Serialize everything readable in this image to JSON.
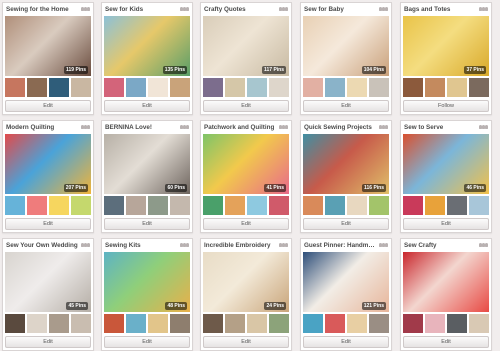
{
  "boards": [
    {
      "title": "Sewing for the Home",
      "pins": "119 Pins",
      "button": "Edit",
      "cover": [
        "#b08f7a",
        "#6b4d3f",
        "#d9cbbf"
      ],
      "thumbs": [
        "#c6765f",
        "#8a6a52",
        "#2f5d7a",
        "#c9b7a2"
      ]
    },
    {
      "title": "Sew for Kids",
      "pins": "135 Pins",
      "button": "Edit",
      "cover": [
        "#8cc1d8",
        "#5a9e68",
        "#e6c86a"
      ],
      "thumbs": [
        "#d3647a",
        "#7ba8c6",
        "#f1e5d7",
        "#c9a37a"
      ]
    },
    {
      "title": "Crafty Quotes",
      "pins": "117 Pins",
      "button": "Edit",
      "cover": [
        "#d9cdb9",
        "#c8baa2",
        "#eee4d4"
      ],
      "thumbs": [
        "#7c6d8d",
        "#d5c7a8",
        "#a7c6cf",
        "#ded6cb"
      ]
    },
    {
      "title": "Sew for Baby",
      "pins": "104 Pins",
      "button": "Edit",
      "cover": [
        "#e8d0b4",
        "#c9a07a",
        "#f5e9db"
      ],
      "thumbs": [
        "#e2b0a3",
        "#8ab3c9",
        "#ecd9b2",
        "#c9c2b9"
      ]
    },
    {
      "title": "Bags and Totes",
      "pins": "37 Pins",
      "button": "Follow",
      "cover": [
        "#e9c348",
        "#d9a92a",
        "#f4dd80"
      ],
      "thumbs": [
        "#8c5a3c",
        "#c48a5e",
        "#e0c690",
        "#7b6a5e"
      ]
    },
    {
      "title": "Modern Quilting",
      "pins": "207 Pins",
      "button": "Edit",
      "cover": [
        "#e24a4a",
        "#f0b43a",
        "#4aa3d9"
      ],
      "thumbs": [
        "#66b3d9",
        "#ef7c7c",
        "#f6d65f",
        "#c5d86d"
      ]
    },
    {
      "title": "BERNINA Love!",
      "pins": "60 Pins",
      "button": "Edit",
      "cover": [
        "#b7b0a6",
        "#6e655e",
        "#e3ddd5"
      ],
      "thumbs": [
        "#5c6e7c",
        "#b7a69a",
        "#8d9a8a",
        "#c4b8ad"
      ]
    },
    {
      "title": "Patchwork and Quilting",
      "pins": "41 Pins",
      "button": "Edit",
      "cover": [
        "#7ec468",
        "#e86a8a",
        "#f2c94c"
      ],
      "thumbs": [
        "#4aa06a",
        "#e4a25a",
        "#8ec9e0",
        "#d05a6a"
      ]
    },
    {
      "title": "Quick Sewing Projects",
      "pins": "116 Pins",
      "button": "Edit",
      "cover": [
        "#3f8fa3",
        "#e0c06a",
        "#c75a4a"
      ],
      "thumbs": [
        "#d98a5a",
        "#5aa0b4",
        "#e8d8c0",
        "#a3c46a"
      ]
    },
    {
      "title": "Sew to Serve",
      "pins": "46 Pins",
      "button": "Edit",
      "cover": [
        "#d9502f",
        "#f2c14a",
        "#7bb6d9"
      ],
      "thumbs": [
        "#c93a5a",
        "#e8a23a",
        "#6a6e74",
        "#a8c6d9"
      ]
    },
    {
      "title": "Sew Your Own Wedding",
      "pins": "45 Pins",
      "button": "Edit",
      "cover": [
        "#d8d4cf",
        "#b5aea6",
        "#efeceb"
      ],
      "thumbs": [
        "#5a4a3e",
        "#ddd4c9",
        "#a99b8c",
        "#c9bdb0"
      ]
    },
    {
      "title": "Sewing Kits",
      "pins": "48 Pins",
      "button": "Edit",
      "cover": [
        "#5db3c4",
        "#e9b04a",
        "#8fcf7a"
      ],
      "thumbs": [
        "#c9573a",
        "#6ab0c9",
        "#e2c58a",
        "#8e7e6e"
      ]
    },
    {
      "title": "Incredible Embroidery",
      "pins": "24 Pins",
      "button": "Edit",
      "cover": [
        "#e8dcc6",
        "#c9a57a",
        "#f3ead9"
      ],
      "thumbs": [
        "#6e5a4a",
        "#b4a087",
        "#d9c6a6",
        "#8ca37a"
      ]
    },
    {
      "title": "Guest Pinner: Handmade C...",
      "pins": "121 Pins",
      "button": "Edit",
      "cover": [
        "#2d4e7a",
        "#e7b59a",
        "#f2ede6"
      ],
      "thumbs": [
        "#4aa3c4",
        "#d95a5a",
        "#e8cfa3",
        "#9a8e84"
      ]
    },
    {
      "title": "Sew Crafty",
      "pins": "",
      "button": "Edit",
      "cover": [
        "#c9262c",
        "#e84a44",
        "#f3d6cf"
      ],
      "thumbs": [
        "#a13a4a",
        "#e8b4bc",
        "#5a5e62",
        "#d9c9b4"
      ]
    }
  ]
}
